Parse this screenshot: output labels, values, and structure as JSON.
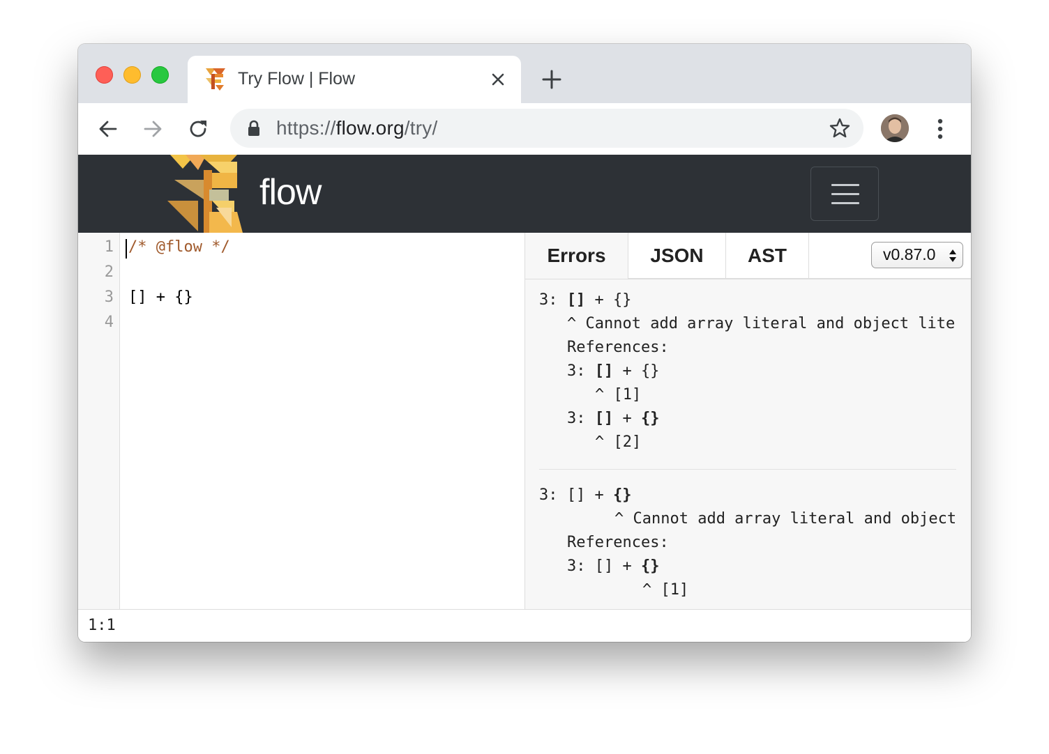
{
  "browser": {
    "tab": {
      "title": "Try Flow | Flow"
    },
    "url": {
      "scheme": "https://",
      "host": "flow.org",
      "path": "/try/"
    }
  },
  "navbar": {
    "brand": "flow"
  },
  "editor": {
    "line_numbers": [
      "1",
      "2",
      "3",
      "4"
    ],
    "lines": [
      "/* @flow */",
      "",
      "[] + {}",
      ""
    ]
  },
  "results": {
    "tabs": [
      "Errors",
      "JSON",
      "AST"
    ],
    "version": "v0.87.0",
    "errors": [
      {
        "prefix": "3: ",
        "code_bold": "[]",
        "code_rest": " + {}",
        "message": "^ Cannot add array literal and object lite",
        "references_label": "References:",
        "references": [
          {
            "prefix": "3: ",
            "bold_a": "[]",
            "mid": " + ",
            "bold_b": "",
            "rest": "{}",
            "marker": "^ [1]"
          },
          {
            "prefix": "3: ",
            "bold_a": "[]",
            "mid": " + ",
            "bold_b": "{}",
            "rest": "",
            "marker": "^ [2]"
          }
        ]
      },
      {
        "prefix": "3: ",
        "code_plain": "[] + ",
        "code_bold": "{}",
        "message": "^ Cannot add array literal and object",
        "references_label": "References:",
        "references": [
          {
            "prefix": "3: ",
            "plain": "[] + ",
            "bold": "{}",
            "marker": "^ [1]"
          }
        ]
      }
    ]
  },
  "status": {
    "position": "1:1"
  }
}
